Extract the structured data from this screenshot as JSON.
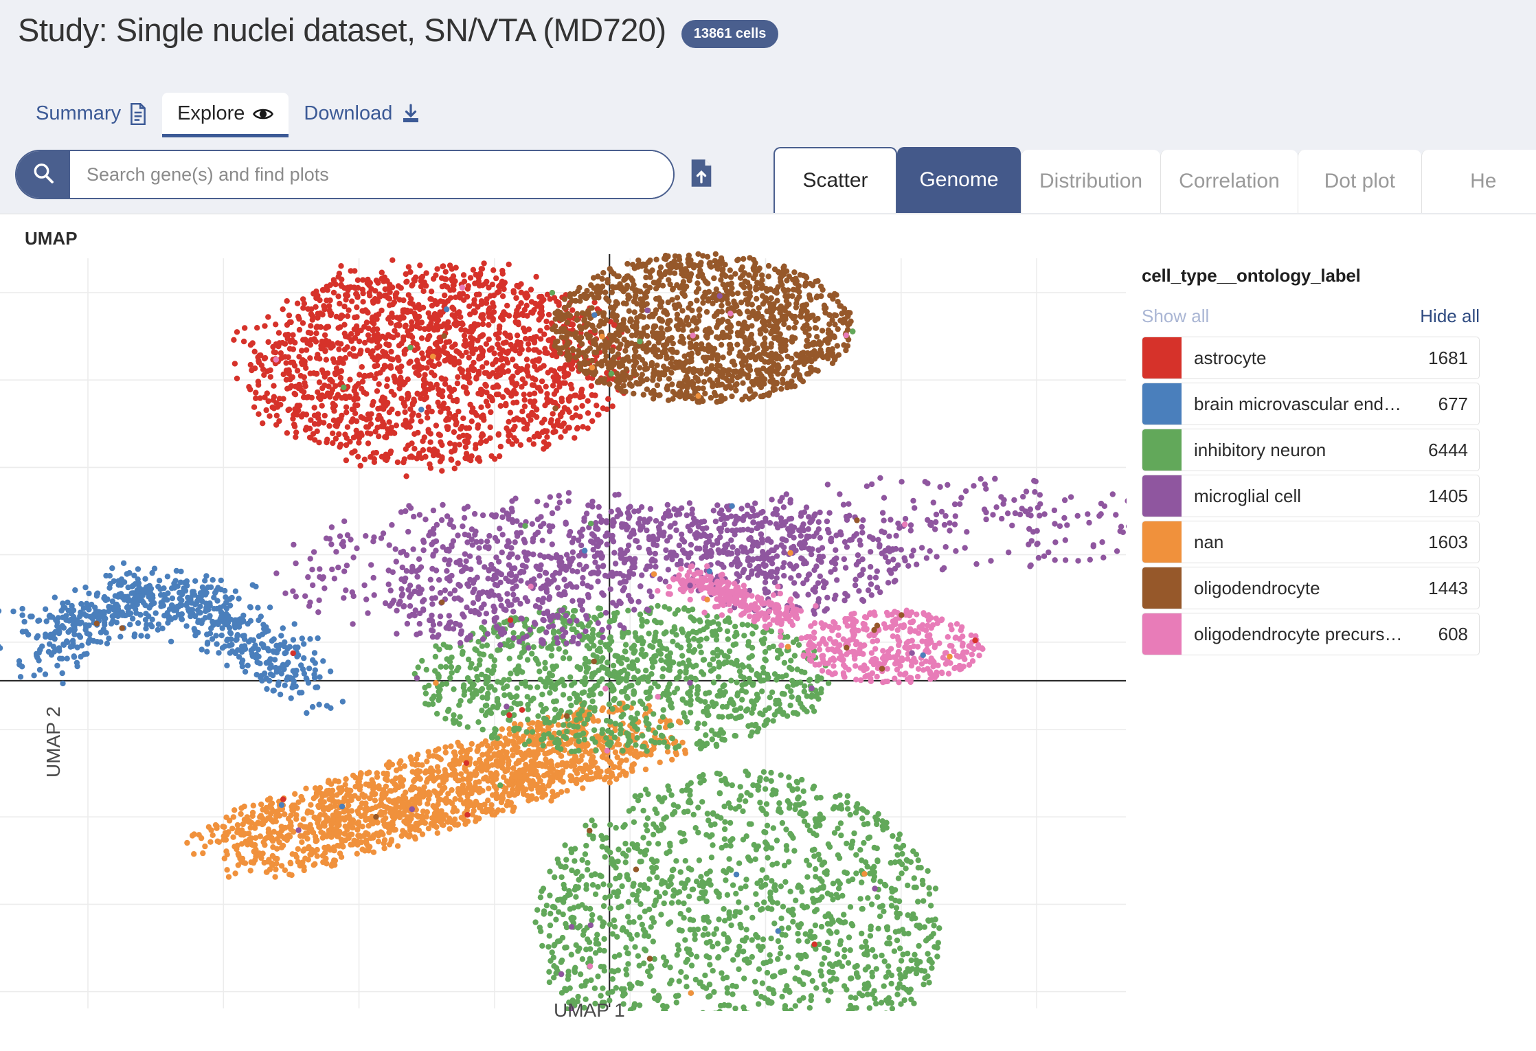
{
  "header": {
    "study_title": "Study: Single nuclei dataset, SN/VTA (MD720)",
    "cells_badge": "13861 cells",
    "nav_tabs": [
      {
        "label": "Summary",
        "icon": "document-icon",
        "active": false
      },
      {
        "label": "Explore",
        "icon": "eye-icon",
        "active": true
      },
      {
        "label": "Download",
        "icon": "download-icon",
        "active": false
      }
    ]
  },
  "search": {
    "placeholder": "Search gene(s) and find plots",
    "value": "",
    "search_icon": "magnifier-icon",
    "upload_icon": "file-upload-icon"
  },
  "plot_tabs": [
    {
      "label": "Scatter",
      "state": "selected"
    },
    {
      "label": "Genome",
      "state": "highlighted"
    },
    {
      "label": "Distribution",
      "state": "normal"
    },
    {
      "label": "Correlation",
      "state": "normal"
    },
    {
      "label": "Dot plot",
      "state": "normal"
    },
    {
      "label": "He",
      "state": "clipped"
    }
  ],
  "plot": {
    "title": "UMAP",
    "xlabel": "UMAP 1",
    "ylabel": "UMAP 2"
  },
  "legend": {
    "title": "cell_type__ontology_label",
    "show_all": "Show all",
    "hide_all": "Hide all",
    "items": [
      {
        "label": "astrocyte",
        "count": "1681",
        "color": "#d6322a"
      },
      {
        "label": "brain microvascular end…",
        "count": "677",
        "color": "#4a7fbc"
      },
      {
        "label": "inhibitory neuron",
        "count": "6444",
        "color": "#62a85a"
      },
      {
        "label": "microglial cell",
        "count": "1405",
        "color": "#8f569f"
      },
      {
        "label": "nan",
        "count": "1603",
        "color": "#f0913c"
      },
      {
        "label": "oligodendrocyte",
        "count": "1443",
        "color": "#96582a"
      },
      {
        "label": "oligodendrocyte precurs…",
        "count": "608",
        "color": "#e87cb8"
      }
    ]
  },
  "chart_data": {
    "type": "scatter",
    "title": "UMAP",
    "xlabel": "UMAP 1",
    "ylabel": "UMAP 2",
    "grid": true,
    "legend_position": "right",
    "axis_origin_lines": true,
    "total_points": 13861,
    "series": [
      {
        "name": "astrocyte",
        "color": "#d6322a",
        "count": 1681,
        "centroid": [
          -0.95,
          2.55
        ],
        "spread": [
          0.95,
          0.78
        ]
      },
      {
        "name": "brain microvascular endothelial cell",
        "color": "#4a7fbc",
        "count": 677,
        "centroid": [
          -2.35,
          0.18
        ],
        "spread": [
          0.62,
          0.4
        ]
      },
      {
        "name": "inhibitory neuron",
        "color": "#62a85a",
        "count": 6444,
        "centroid": [
          0.22,
          -1.2
        ],
        "spread": [
          1.2,
          1.55
        ]
      },
      {
        "name": "microglial cell",
        "color": "#8f569f",
        "count": 1405,
        "centroid": [
          0.55,
          1.0
        ],
        "spread": [
          1.45,
          0.6
        ]
      },
      {
        "name": "nan",
        "color": "#f0913c",
        "count": 1603,
        "centroid": [
          -1.2,
          -0.95
        ],
        "spread": [
          0.78,
          0.48
        ]
      },
      {
        "name": "oligodendrocyte",
        "color": "#96582a",
        "count": 1443,
        "centroid": [
          0.5,
          2.7
        ],
        "spread": [
          0.78,
          0.62
        ]
      },
      {
        "name": "oligodendrocyte precursor cell",
        "color": "#e87cb8",
        "count": 608,
        "centroid": [
          1.35,
          0.48
        ],
        "spread": [
          0.48,
          0.34
        ]
      }
    ],
    "xlim": [
      -3.3,
      2.8
    ],
    "ylim": [
      -2.6,
      3.4
    ]
  }
}
